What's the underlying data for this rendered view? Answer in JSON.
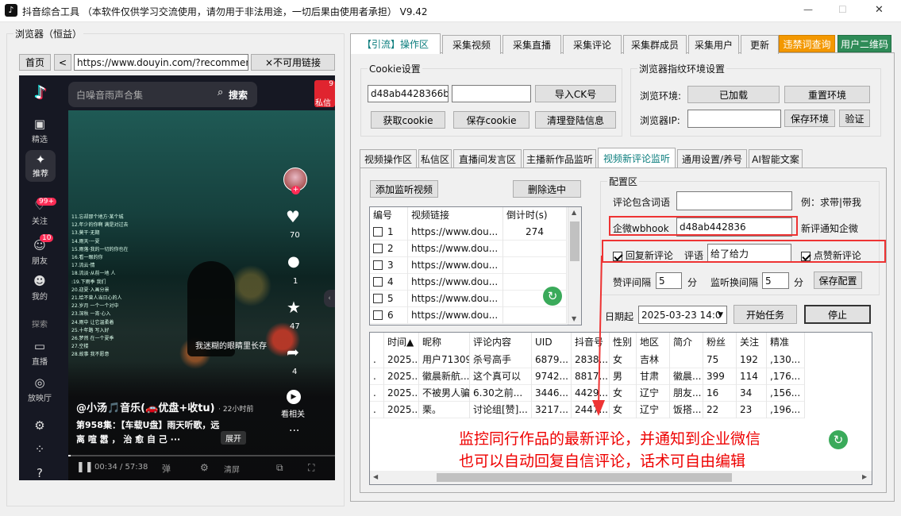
{
  "window": {
    "title": "抖音综合工具 （本软件仅供学习交流使用，请勿用于非法用途，一切后果由使用者承担）  V9.42",
    "min": "—",
    "max": "☐",
    "close": "✕"
  },
  "browser": {
    "group_title": "浏览器（恒益）",
    "home": "首页",
    "back": "<",
    "url": "https://www.douyin.com/?recommend=1",
    "unavailable": "×不可用链接"
  },
  "douyin": {
    "search_text": "白噪音雨声合集",
    "search_btn": "搜索",
    "msg_badge": "9",
    "msg_label": "私信",
    "nav": [
      {
        "icon": "精",
        "label": "精选"
      },
      {
        "icon": "✦",
        "label": "推荐"
      },
      {
        "icon": "关",
        "label": "关注",
        "badge": "99+"
      },
      {
        "icon": "朋",
        "label": "朋友",
        "badge": "10"
      },
      {
        "icon": "我",
        "label": "我的"
      }
    ],
    "nav_search": "探索",
    "nav_live": "直播",
    "nav_cinema": "放映厅",
    "likes": "70",
    "comments": "1",
    "favorites": "47",
    "shares": "4",
    "related": "看相关",
    "video_caption": "我迷糊的眼睛里长存",
    "lyrics": [
      "11.忘却那个地方·某个城",
      "12.年少的你啊 满是对过去",
      "13.莫干·无期",
      "14.雨天·一夏",
      "15.雨落·我的一切的你也在",
      "16.看一眼的你",
      "17.流云·情",
      "18.流淡·从前一地 人",
      ":19.下雨季 我们",
      "20.迎夏·入画分景",
      "21.给不曾人当日心的人",
      "22.岁月 一个一个对中",
      "23.深秋 一宵·心入",
      "24.雨中 让它温柔着",
      "25.十年路 写入好",
      "26.梦然 在一个夏季",
      "27.空楼",
      "28.故事 我不愿意"
    ],
    "author": "@小汤🎵音乐(🚗优盘+收tu)",
    "time_ago": "· 22小时前",
    "desc1": "第958集：【车载U盘】雨天听歌，远",
    "desc2": "离 喧 嚣 ， 治 愈 自 己 ···",
    "expand": "展开",
    "progress": "00:34 / 57:38",
    "danmu": "弹",
    "quality": "清屏",
    "progress_fraction": 0.01
  },
  "top_tabs": [
    "【引流】操作区",
    "采集视频",
    "采集直播",
    "采集评论",
    "采集群成员",
    "采集用户",
    "更新"
  ],
  "btn_banned": "违禁词查询",
  "btn_qr": "用户二维码",
  "cookie": {
    "title": "Cookie设置",
    "value": "d48ab4428366be",
    "value2": "",
    "import": "导入CK号",
    "get": "获取cookie",
    "save": "保存cookie",
    "clear": "清理登陆信息"
  },
  "env": {
    "title": "浏览器指纹环境设置",
    "env_label": "浏览环境:",
    "loaded": "已加载",
    "reset": "重置环境",
    "ip_label": "浏览器IP:",
    "ip": "",
    "save": "保存环境",
    "verify": "验证"
  },
  "sub_tabs": [
    "视频操作区",
    "私信区",
    "直播间发言区",
    "主播新作品监听",
    "视频新评论监听",
    "通用设置/养号",
    "AI智能文案"
  ],
  "monitor": {
    "add": "添加监听视频",
    "delete": "删除选中",
    "headers": [
      "编号",
      "视频链接",
      "倒计时(s)"
    ],
    "rows": [
      {
        "n": "1",
        "url": "https://www.dou...",
        "cd": "274"
      },
      {
        "n": "2",
        "url": "https://www.dou...",
        "cd": ""
      },
      {
        "n": "3",
        "url": "https://www.dou...",
        "cd": ""
      },
      {
        "n": "4",
        "url": "https://www.dou...",
        "cd": ""
      },
      {
        "n": "5",
        "url": "https://www.dou...",
        "cd": ""
      },
      {
        "n": "6",
        "url": "https://www.dou...",
        "cd": ""
      }
    ]
  },
  "config": {
    "title": "配置区",
    "kw_label": "评论包含词语",
    "kw_value": "",
    "example": "例：求带|带我",
    "wb_label": "企微wbhook",
    "wb_value": "d48ab442836",
    "wb_note": "新评通知企微",
    "reply_label": "回复新评论",
    "reply_text_label": "评语",
    "reply_text": "给了给力",
    "like_label": "点赞新评论",
    "like_interval_label": "赞评间隔",
    "like_interval": "5",
    "unit1": "分",
    "switch_label": "监听换间隔",
    "switch_interval": "5",
    "unit2": "分",
    "save": "保存配置",
    "date_label": "日期起",
    "date": "2025-03-23 14:0",
    "start": "开始任务",
    "stop": "停止"
  },
  "results": {
    "headers": [
      "",
      "时间▲",
      "昵称",
      "评论内容",
      "UID",
      "抖音号",
      "性别",
      "地区",
      "简介",
      "粉丝",
      "关注",
      "精准"
    ],
    "rows": [
      [
        ".",
        "2025...",
        "用户71309...",
        "杀号高手",
        "6879...",
        "2838...",
        "女",
        "吉林",
        "",
        "75",
        "192",
        ",130..."
      ],
      [
        ".",
        "2025...",
        "徽晨新航...",
        "这个真可以",
        "9742...",
        "8817...",
        "男",
        "甘肃",
        "徽晨...",
        "399",
        "114",
        ",176..."
      ],
      [
        ".",
        "2025...",
        "不被男人骗",
        "6.30之前...",
        "3446...",
        "4429...",
        "女",
        "辽宁",
        "朋友...",
        "16",
        "34",
        ",156..."
      ],
      [
        ".",
        "2025...",
        "栗。",
        "讨论组[赞]...",
        "3217...",
        "2447...",
        "女",
        "辽宁",
        "饭搭...",
        "22",
        "23",
        ",196..."
      ]
    ]
  },
  "annotation": {
    "line1": "监控同行作品的最新评论，并通知到企业微信",
    "line2": "也可以自动回复自信评论，话术可自由编辑"
  },
  "colors": {
    "accent": "#0a7d7d",
    "banned": "#f39800",
    "qr": "#2e8b57",
    "annotation": "#e00000",
    "refresh": "#3aaa5a"
  }
}
